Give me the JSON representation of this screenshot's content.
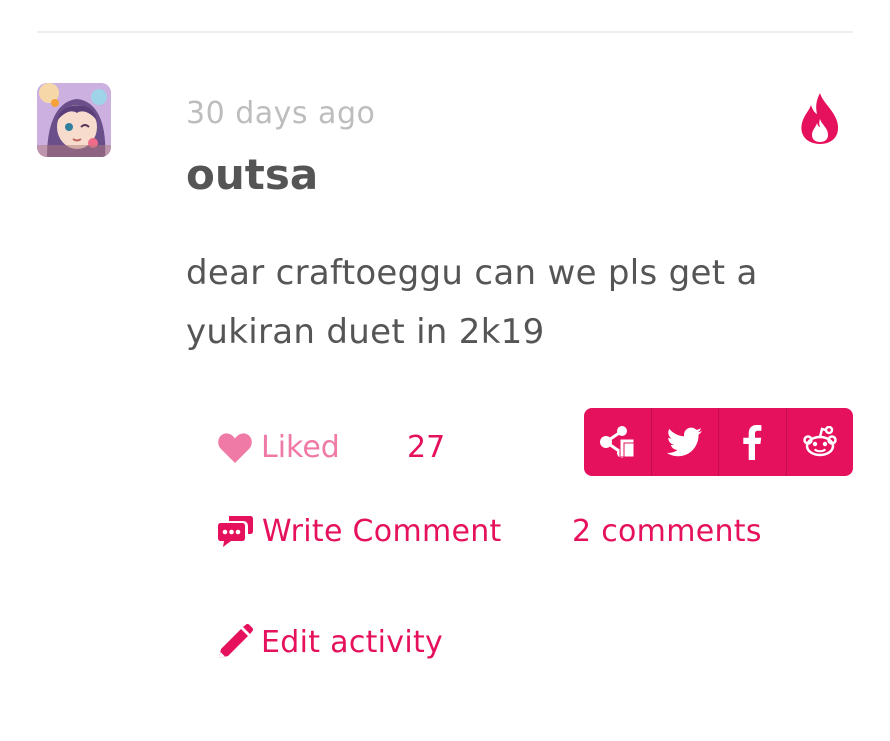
{
  "activity": {
    "timestamp": "30 days ago",
    "username": "outsa",
    "message": "dear craftoeggu can we pls get a yukiran duet in 2k19",
    "hot_icon": "fire-icon",
    "avatar": "user-avatar"
  },
  "actions": {
    "liked_label": "Liked",
    "liked_icon": "heart-icon",
    "like_count": "27",
    "write_comment_label": "Write Comment",
    "write_comment_icon": "comment-icon",
    "comment_count": "2 comments",
    "edit_label": "Edit activity",
    "edit_icon": "pencil-icon"
  },
  "share": {
    "buttons": [
      "share-icon",
      "twitter-icon",
      "facebook-icon",
      "reddit-icon"
    ]
  },
  "colors": {
    "accent": "#e6115c",
    "liked_text": "#f07aa6",
    "muted_text": "#bdbdbd",
    "body_text": "#555555"
  }
}
